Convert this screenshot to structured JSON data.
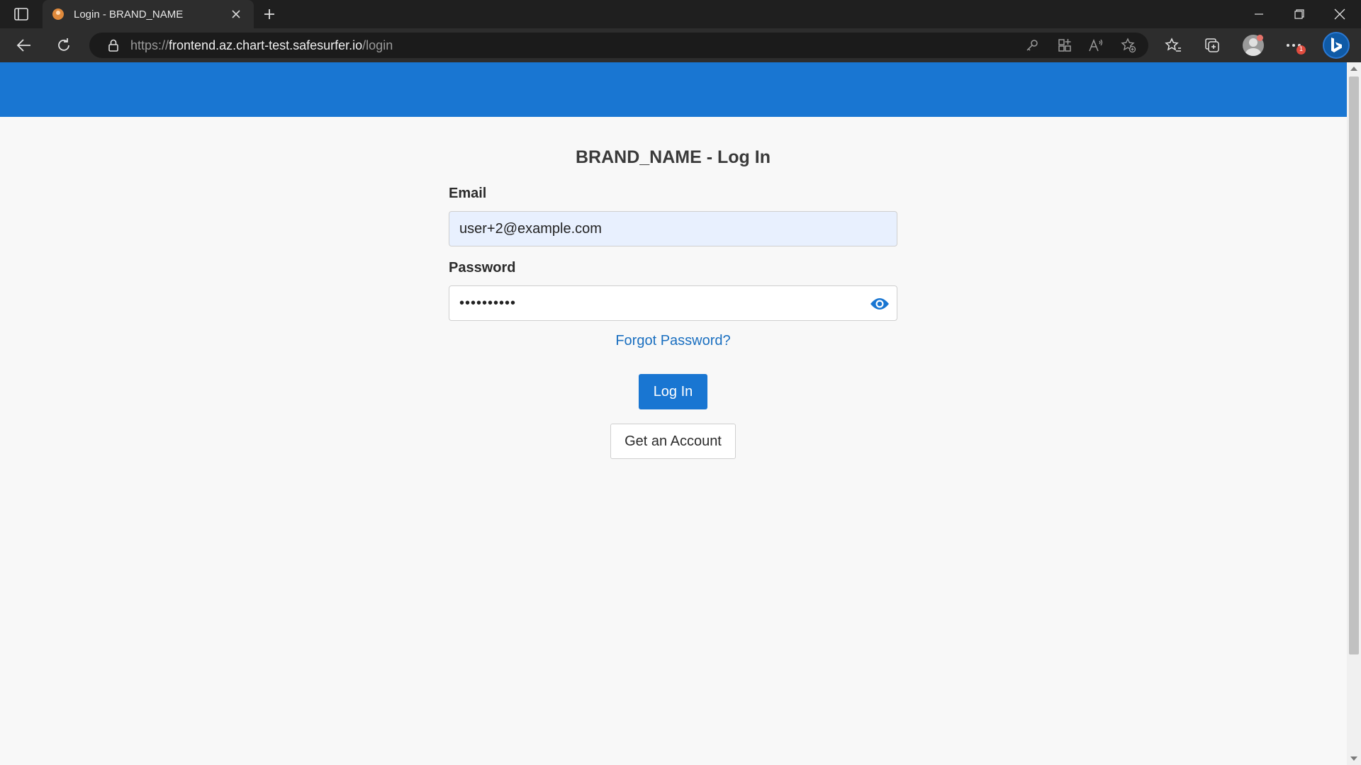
{
  "browser": {
    "tab": {
      "title": "Login - BRAND_NAME"
    },
    "address": {
      "url_prefix": "https://",
      "url_host": "frontend.az.chart-test.safesurfer.io",
      "url_path": "/login"
    },
    "menu_badge": "1",
    "icons": {
      "tab_actions": "tab-actions-icon",
      "close_tab": "close-icon",
      "new_tab": "plus-icon",
      "minimize": "minimize-icon",
      "restore": "restore-icon",
      "close_window": "close-icon",
      "back": "back-arrow-icon",
      "refresh": "refresh-icon",
      "lock": "lock-icon",
      "key": "key-icon",
      "apps": "apps-icon",
      "read_aloud": "read-aloud-icon",
      "add_favorite": "star-plus-icon",
      "favorites": "favorites-icon",
      "collections": "collections-icon",
      "profile": "profile-icon",
      "more": "more-icon",
      "bing": "bing-icon"
    }
  },
  "page": {
    "header_color": "#1976d2",
    "title": "BRAND_NAME - Log In",
    "email": {
      "label": "Email",
      "value": "user+2@example.com"
    },
    "password": {
      "label": "Password",
      "masked_value": "••••••••••"
    },
    "forgot_link": "Forgot Password?",
    "login_button": "Log In",
    "account_button": "Get an Account"
  }
}
